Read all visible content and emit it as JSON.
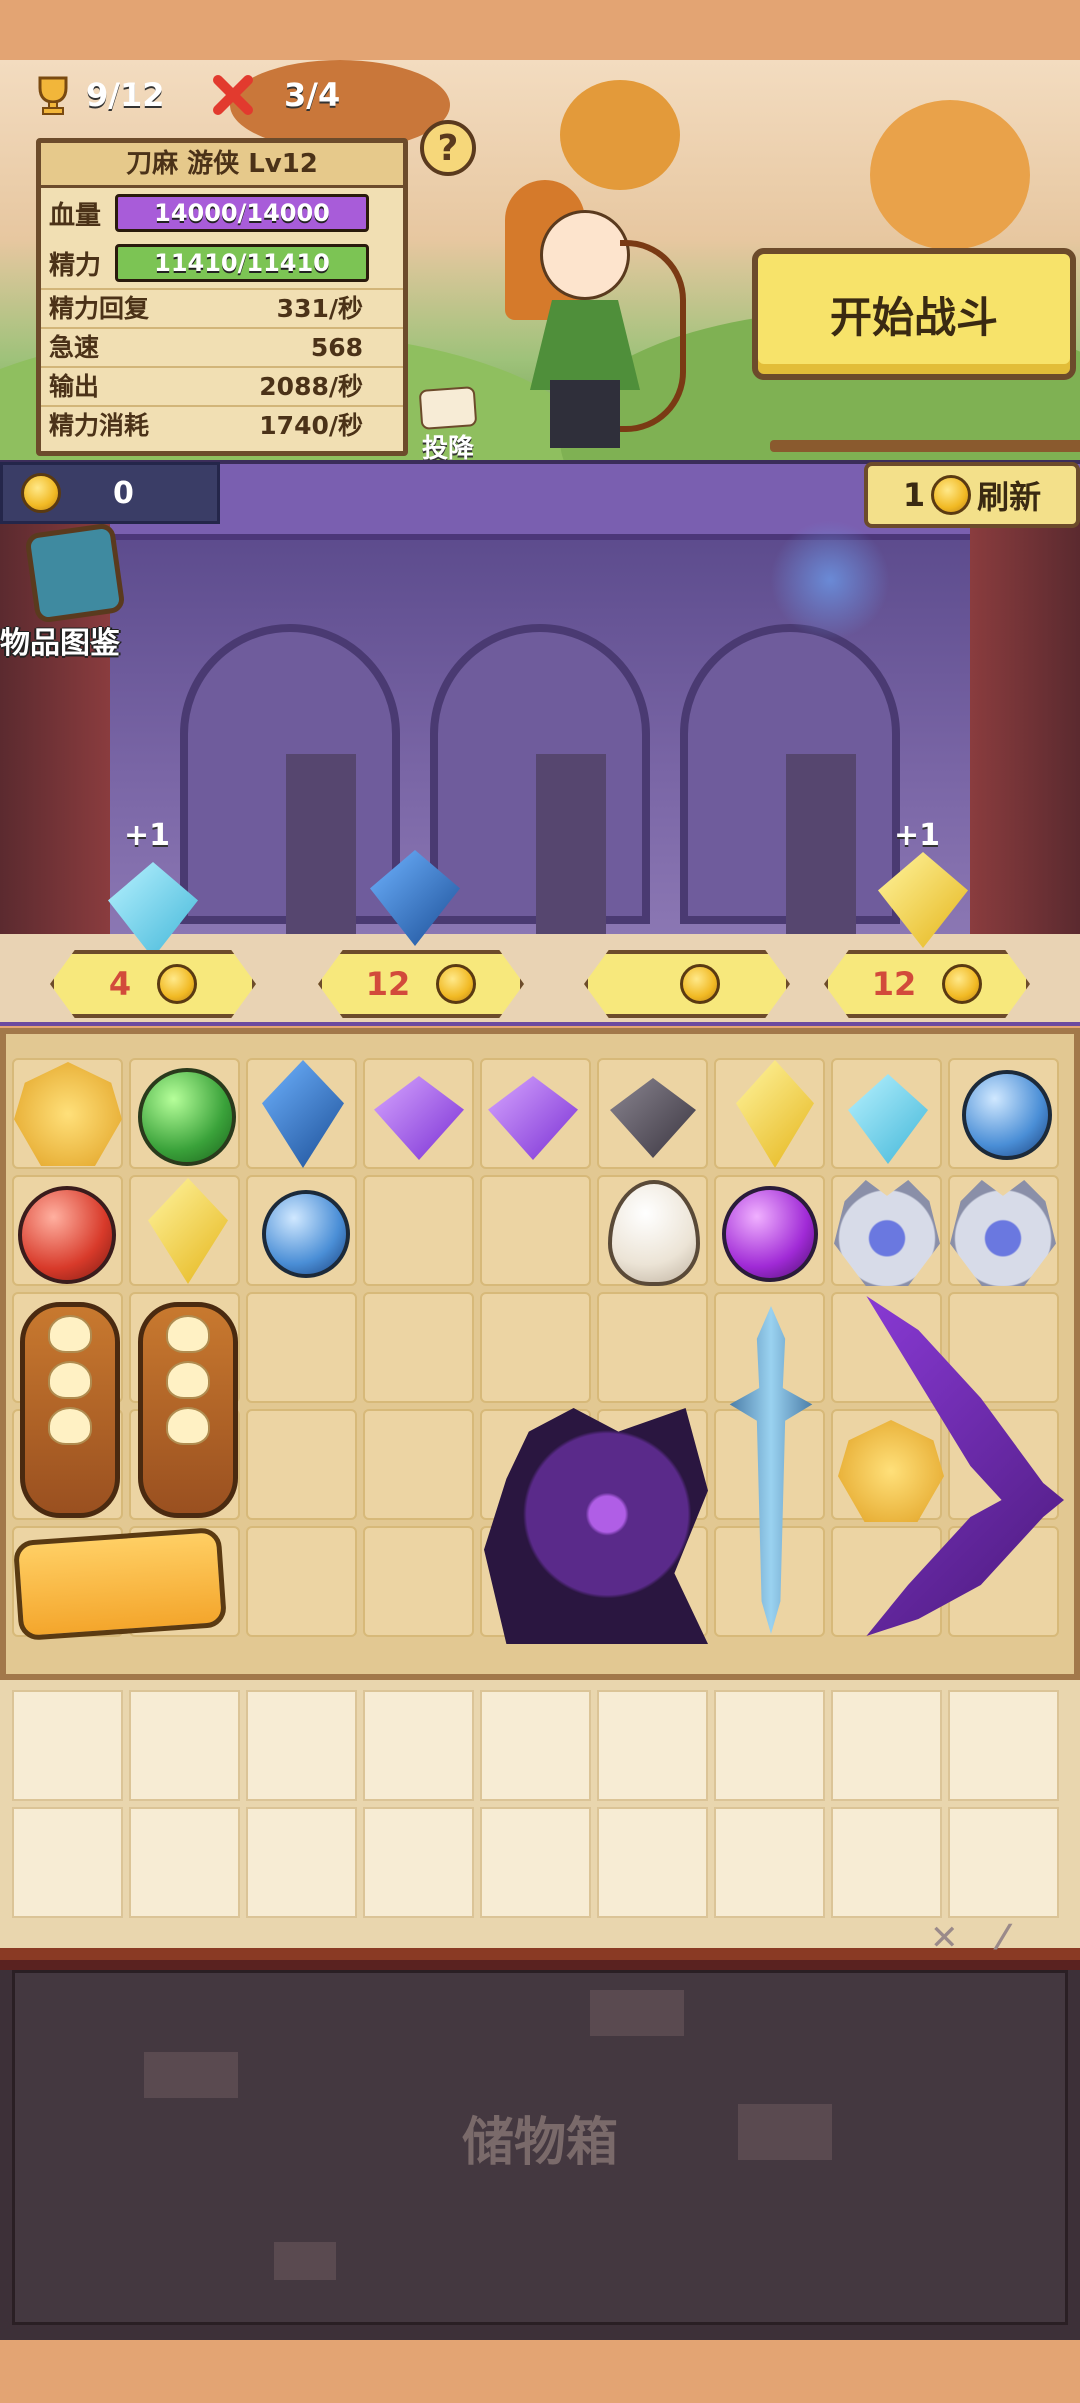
{
  "top_stats": {
    "wins": "9/12",
    "losses": "3/4"
  },
  "hero_panel": {
    "title": "刀麻 游侠 Lv12",
    "hp_label": "血量",
    "hp_value": "14000/14000",
    "sp_label": "精力",
    "sp_value": "11410/11410",
    "rows": [
      {
        "label": "精力回复",
        "value": "331/秒"
      },
      {
        "label": "急速",
        "value": "568"
      },
      {
        "label": "输出",
        "value": "2088/秒"
      },
      {
        "label": "精力消耗",
        "value": "1740/秒"
      }
    ]
  },
  "help_label": "?",
  "surrender_label": "投降",
  "start_battle_label": "开始战斗",
  "shop": {
    "gold": "0",
    "refresh_cost": "1",
    "refresh_label": "刷新",
    "catalog_label": "物品图鉴",
    "slots": [
      {
        "plus": "+1",
        "price": "4",
        "item": "cyan-crystal-icon"
      },
      {
        "plus": "",
        "price": "12",
        "item": "blue-crystal-icon"
      },
      {
        "plus": "",
        "price": "",
        "item": "empty"
      },
      {
        "plus": "+1",
        "price": "12",
        "item": "yellow-crystal-icon"
      }
    ]
  },
  "backpack_items": [
    "gold-emblem-icon",
    "green-orb-icon",
    "blue-crystal-icon",
    "purple-crystal-icon",
    "purple-crystal-icon",
    "dark-rock-icon",
    "yellow-crystal-icon",
    "cyan-crystal-icon",
    "blue-orb-icon",
    "red-orb-icon",
    "yellow-crystal-icon",
    "blue-orb-icon",
    "egg-icon",
    "violet-orb-icon",
    "silver-helm-icon",
    "silver-helm-icon",
    "bread-icon",
    "bread-icon",
    "drink-cup-icon",
    "shadow-dragon-icon",
    "ice-sword-icon",
    "gold-emblem-icon",
    "purple-crossbow-icon"
  ],
  "storage_label": "储物箱",
  "colors": {
    "accent": "#f7e36a",
    "hp_bar": "#a85cd9",
    "sp_bar": "#7cc454",
    "price_text": "#d24a3b"
  }
}
